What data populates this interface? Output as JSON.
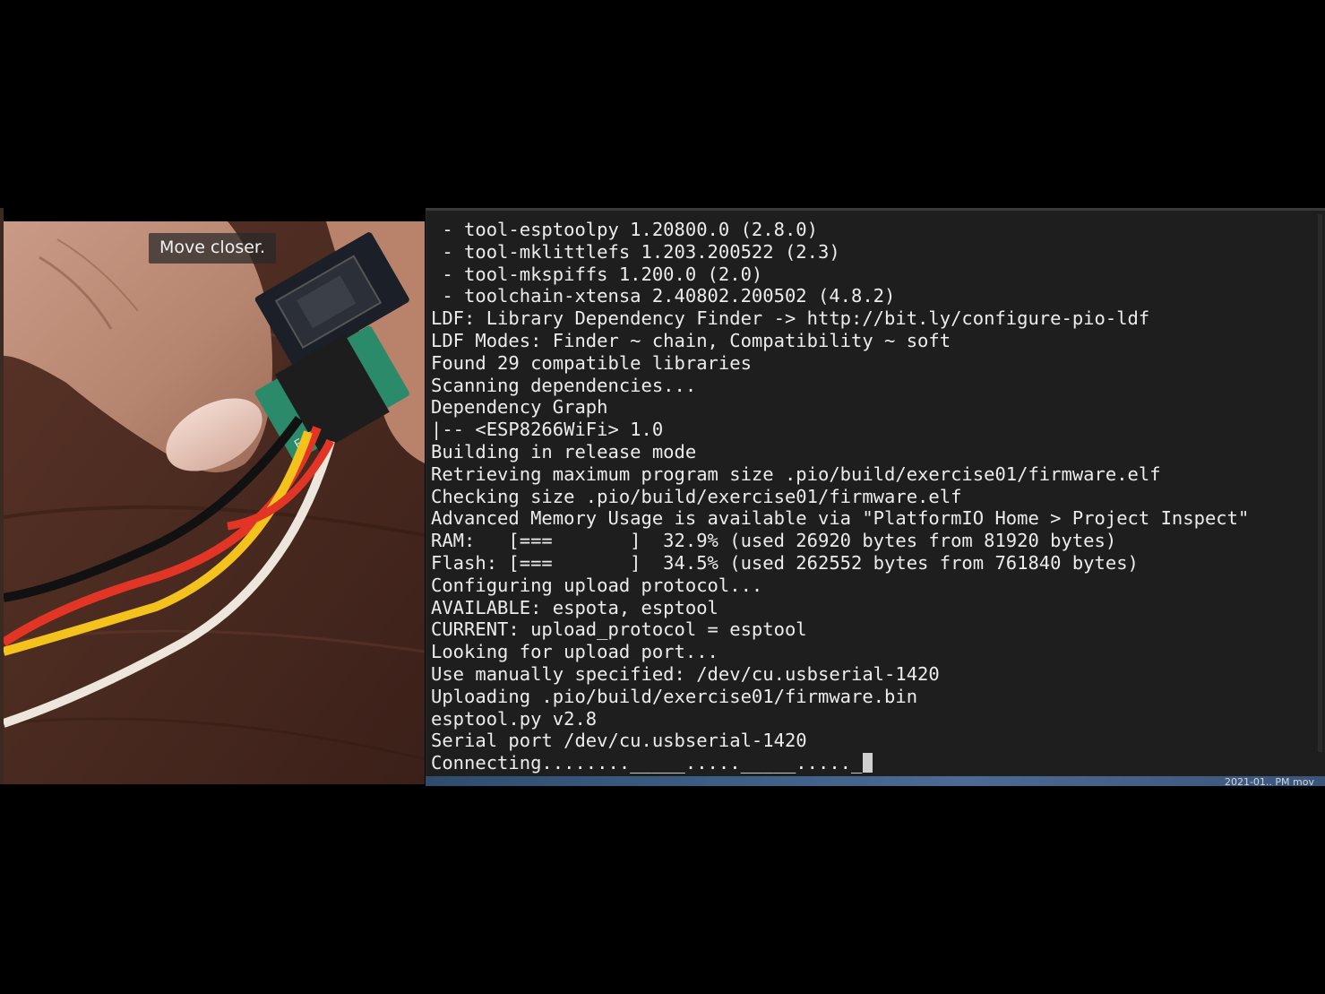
{
  "camera": {
    "hint": "Move closer."
  },
  "terminal": {
    "lines": [
      " - tool-esptoolpy 1.20800.0 (2.8.0)",
      " - tool-mklittlefs 1.203.200522 (2.3)",
      " - tool-mkspiffs 1.200.0 (2.0)",
      " - toolchain-xtensa 2.40802.200502 (4.8.2)",
      "LDF: Library Dependency Finder -> http://bit.ly/configure-pio-ldf",
      "LDF Modes: Finder ~ chain, Compatibility ~ soft",
      "Found 29 compatible libraries",
      "Scanning dependencies...",
      "Dependency Graph",
      "|-- <ESP8266WiFi> 1.0",
      "Building in release mode",
      "Retrieving maximum program size .pio/build/exercise01/firmware.elf",
      "Checking size .pio/build/exercise01/firmware.elf",
      "Advanced Memory Usage is available via \"PlatformIO Home > Project Inspect\"",
      "RAM:   [===       ]  32.9% (used 26920 bytes from 81920 bytes)",
      "Flash: [===       ]  34.5% (used 262552 bytes from 761840 bytes)",
      "Configuring upload protocol...",
      "AVAILABLE: espota, esptool",
      "CURRENT: upload_protocol = esptool",
      "Looking for upload port...",
      "Use manually specified: /dev/cu.usbserial-1420",
      "Uploading .pio/build/exercise01/firmware.bin",
      "esptool.py v2.8",
      "Serial port /dev/cu.usbserial-1420",
      "Connecting........_____....._____....._"
    ],
    "cursor_after_last_line": true
  },
  "desktop": {
    "clock": "2021-01.. PM mov"
  }
}
